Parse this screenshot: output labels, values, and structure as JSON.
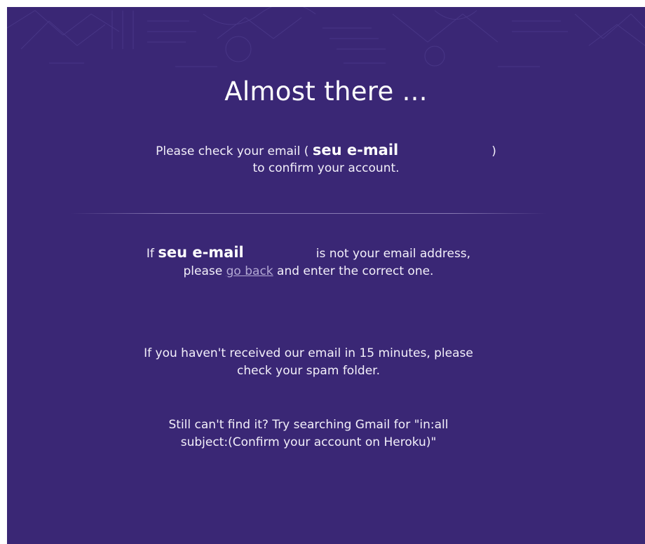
{
  "title": "Almost there ...",
  "confirm": {
    "before": "Please check your email (",
    "email": "seu e-mail",
    "after": ")",
    "line2": "to confirm your account."
  },
  "wrong_email": {
    "prefix": "If",
    "email": "seu e-mail",
    "middle": "is not your email address, please",
    "link": "go back",
    "suffix": "and enter the correct one."
  },
  "spam_notice": "If you haven't received our email in 15 minutes, please check your spam folder.",
  "gmail_hint": "Still can't find it? Try searching Gmail for \"in:all subject:(Confirm your account on Heroku)\"",
  "colors": {
    "background": "#3a2775",
    "text": "#ffffff",
    "link": "#b3a9d4"
  }
}
